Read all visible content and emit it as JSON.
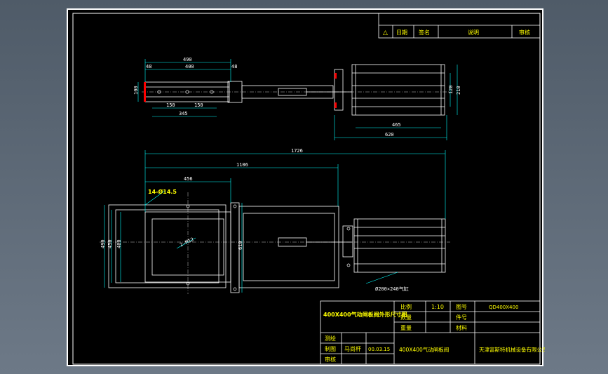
{
  "revision_table": {
    "headers": [
      "△",
      "日期",
      "签名",
      "说明",
      "审核"
    ]
  },
  "top_view": {
    "dims": [
      "490",
      "400",
      "48",
      "48",
      "100",
      "150",
      "150",
      "345",
      "120",
      "210",
      "465",
      "620"
    ]
  },
  "front_view": {
    "dims": [
      "1726",
      "1106",
      "456",
      "14-Ø14.5",
      "490",
      "450",
      "400",
      "2-M12",
      "610"
    ],
    "callout": "Ø200×240气缸"
  },
  "title_block": {
    "drawing_title": "400X400气动闸板阀外形尺寸图",
    "scale_label": "比例",
    "scale_value": "1:10",
    "drawing_no_label": "图号",
    "drawing_no_value": "QD400X400",
    "quantity_label": "数量",
    "part_no_label": "件号",
    "weight_label": "重量",
    "material_label": "材料",
    "draw_label": "测绘",
    "drafted_label": "制图",
    "drafter": "马尚杆",
    "date": "00.03.15",
    "review_label": "审核",
    "product_name": "400X400气动闸板阀",
    "company": "天津富斯特机械设备有限公司"
  },
  "colors": {
    "sheet": "#000000",
    "outline": "#ffffff",
    "dimension": "#00ffff",
    "part": "#ffffff",
    "title_text": "#ffff00",
    "accent": "#ff0000"
  }
}
